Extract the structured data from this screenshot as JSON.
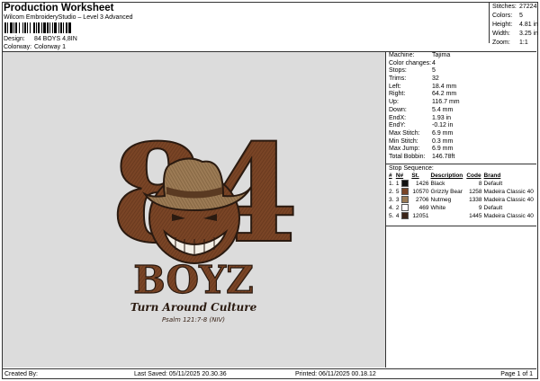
{
  "header": {
    "title": "Production Worksheet",
    "subtitle": "Wilcom EmbroideryStudio – Level 3 Advanced",
    "design_label": "Design:",
    "design_value": "84 BOYS 4,8IN",
    "colorway_label": "Colorway:",
    "colorway_value": "Colorway 1"
  },
  "stats": [
    {
      "label": "Stitches:",
      "value": "27224"
    },
    {
      "label": "Colors:",
      "value": "5"
    },
    {
      "label": "Height:",
      "value": "4.81 in"
    },
    {
      "label": "Width:",
      "value": "3.25 in"
    },
    {
      "label": "Zoom:",
      "value": "1:1"
    }
  ],
  "details": [
    {
      "label": "Machine:",
      "value": "Tajima"
    },
    {
      "label": "Color changes:",
      "value": "4"
    },
    {
      "label": "Stops:",
      "value": "5"
    },
    {
      "label": "Trims:",
      "value": "32"
    },
    {
      "label": "Left:",
      "value": "18.4 mm"
    },
    {
      "label": "Right:",
      "value": "64.2 mm"
    },
    {
      "label": "Up:",
      "value": "116.7 mm"
    },
    {
      "label": "Down:",
      "value": "5.4 mm"
    },
    {
      "label": "EndX:",
      "value": "1.93 in"
    },
    {
      "label": "EndY:",
      "value": "-0.12 in"
    },
    {
      "label": "Max Stitch:",
      "value": "6.9 mm"
    },
    {
      "label": "Min Stitch:",
      "value": "0.3 mm"
    },
    {
      "label": "Max Jump:",
      "value": "6.9 mm"
    },
    {
      "label": "Total Bobbin:",
      "value": "146.78ft"
    }
  ],
  "stop_sequence": {
    "title": "Stop Sequence:",
    "columns": [
      "#",
      "N#",
      "St.",
      "Description",
      "Code",
      "Brand"
    ],
    "rows": [
      {
        "num": "1.",
        "n": "1",
        "color": "#111111",
        "st": "1426",
        "desc": "Black",
        "code": "8",
        "brand": "Default"
      },
      {
        "num": "2.",
        "n": "5",
        "color": "#7a4526",
        "st": "10570",
        "desc": "Grizzly Bear",
        "code": "1258",
        "brand": "Madeira Classic 40"
      },
      {
        "num": "3.",
        "n": "3",
        "color": "#9a7a55",
        "st": "2706",
        "desc": "Nutmeg",
        "code": "1338",
        "brand": "Madeira Classic 40"
      },
      {
        "num": "4.",
        "n": "2",
        "color": "#ffffff",
        "st": "469",
        "desc": "White",
        "code": "9",
        "brand": "Default"
      },
      {
        "num": "5.",
        "n": "4",
        "color": "#3a2418",
        "st": "12051",
        "desc": "",
        "code": "1445",
        "brand": "Madeira Classic 40"
      }
    ]
  },
  "design": {
    "top_text": "84",
    "main_text": "BOYZ",
    "script_text": "Turn Around Culture",
    "verse_text": "Psalm 121:7-8 (NIV)"
  },
  "footer": {
    "created_by": "Created By:",
    "last_saved": "Last Saved: 05/11/2025 20.30.36",
    "printed": "Printed: 06/11/2025 00.18.12",
    "page": "Page 1 of 1"
  }
}
